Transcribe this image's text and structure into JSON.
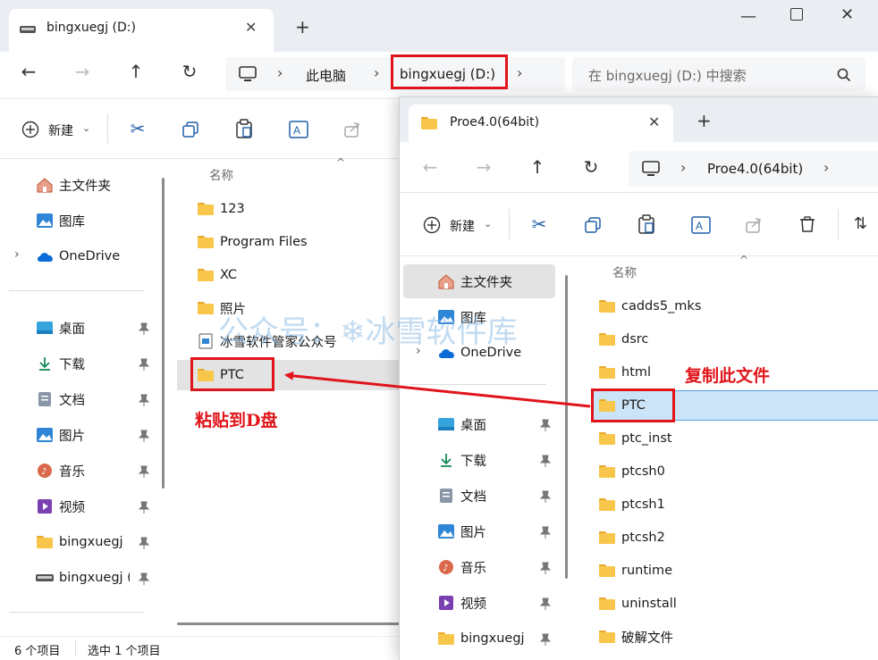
{
  "back_window": {
    "tab_title": "bingxuegj (D:)",
    "breadcrumb": [
      "此电脑",
      "bingxuegj (D:)"
    ],
    "search_placeholder": "在 bingxuegj (D:) 中搜索",
    "new_label": "新建",
    "column_name": "名称",
    "nav_items": [
      {
        "label": "主文件夹",
        "icon": "home-icon"
      },
      {
        "label": "图库",
        "icon": "gallery-icon"
      },
      {
        "label": "OneDrive",
        "icon": "cloud-icon"
      },
      {
        "label": "桌面",
        "icon": "desktop-icon"
      },
      {
        "label": "下载",
        "icon": "download-icon"
      },
      {
        "label": "文档",
        "icon": "document-icon"
      },
      {
        "label": "图片",
        "icon": "pictures-icon"
      },
      {
        "label": "音乐",
        "icon": "music-icon"
      },
      {
        "label": "视频",
        "icon": "video-icon"
      },
      {
        "label": "bingxuegj",
        "icon": "folder-icon"
      },
      {
        "label": "bingxuegj (I",
        "icon": "drive-icon"
      }
    ],
    "files": [
      {
        "name": "123",
        "type": "folder"
      },
      {
        "name": "Program Files",
        "type": "folder"
      },
      {
        "name": "XC",
        "type": "folder"
      },
      {
        "name": "照片",
        "type": "folder"
      },
      {
        "name": "冰雪软件管家公众号",
        "type": "image"
      },
      {
        "name": "PTC",
        "type": "folder"
      }
    ],
    "status_count": "6 个项目",
    "status_selected": "选中 1 个项目"
  },
  "front_window": {
    "tab_title": "Proe4.0(64bit)",
    "breadcrumb": [
      "Proe4.0(64bit)"
    ],
    "new_label": "新建",
    "column_name": "名称",
    "nav_items": [
      {
        "label": "主文件夹",
        "icon": "home-icon"
      },
      {
        "label": "图库",
        "icon": "gallery-icon"
      },
      {
        "label": "OneDrive",
        "icon": "cloud-icon"
      },
      {
        "label": "桌面",
        "icon": "desktop-icon"
      },
      {
        "label": "下载",
        "icon": "download-icon"
      },
      {
        "label": "文档",
        "icon": "document-icon"
      },
      {
        "label": "图片",
        "icon": "pictures-icon"
      },
      {
        "label": "音乐",
        "icon": "music-icon"
      },
      {
        "label": "视频",
        "icon": "video-icon"
      },
      {
        "label": "bingxuegj",
        "icon": "folder-icon"
      }
    ],
    "files": [
      {
        "name": "cadds5_mks"
      },
      {
        "name": "dsrc"
      },
      {
        "name": "html"
      },
      {
        "name": "PTC"
      },
      {
        "name": "ptc_inst"
      },
      {
        "name": "ptcsh0"
      },
      {
        "name": "ptcsh1"
      },
      {
        "name": "ptcsh2"
      },
      {
        "name": "runtime"
      },
      {
        "name": "uninstall"
      },
      {
        "name": "破解文件"
      }
    ]
  },
  "annotations": {
    "copy": "复制此文件",
    "paste": "粘贴到D盘",
    "watermark": "公众号：❄冰雪软件库"
  },
  "colors": {
    "annotation_red": "#e0141a",
    "selection": "#cce4f7",
    "folder": "#f8c64a"
  }
}
